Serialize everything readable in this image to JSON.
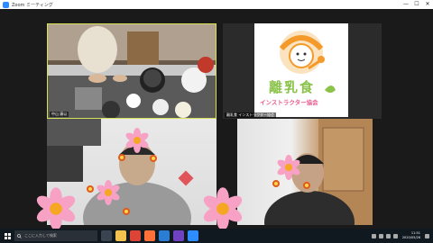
{
  "window": {
    "title": "Zoom ミーティング",
    "controls": [
      "—",
      "☐",
      "✕"
    ]
  },
  "participants": [
    {
      "name": "中山 康以",
      "role": "kitchen-camera"
    },
    {
      "name": "離乳食 インストラクター協会",
      "role": "logo"
    },
    {
      "name": "",
      "role": "camera"
    },
    {
      "name": "",
      "role": "camera"
    }
  ],
  "logo": {
    "line1": "離乳食",
    "line2": "インストラクター協会",
    "colors": {
      "orange": "#f39a2b",
      "green": "#8bc34a",
      "pink": "#e85a8c"
    }
  },
  "taskbar": {
    "search_placeholder": "ここに入力して検索",
    "time": "11:51",
    "date": "2020/05/26"
  }
}
